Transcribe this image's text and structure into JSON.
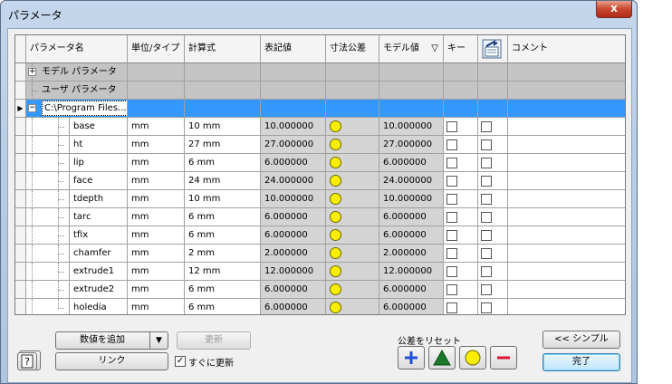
{
  "window": {
    "title": "パラメータ",
    "close": "x"
  },
  "columns": [
    "パラメータ名",
    "単位/タイプ",
    "計算式",
    "表記値",
    "寸法公差",
    "モデル値",
    "キー",
    "",
    "コメント"
  ],
  "sort_arrow": "▽",
  "groups": [
    {
      "name": "モデル パラメータ",
      "expander": "+"
    },
    {
      "name": "ユーザ パラメータ",
      "expander": ""
    },
    {
      "name": "C:\\Program Files...",
      "expander": "−"
    }
  ],
  "rows": [
    {
      "name": "base",
      "unit": "mm",
      "expr": "10 mm",
      "nominal": "10.000000",
      "model": "10.000000"
    },
    {
      "name": "ht",
      "unit": "mm",
      "expr": "27 mm",
      "nominal": "27.000000",
      "model": "27.000000"
    },
    {
      "name": "lip",
      "unit": "mm",
      "expr": "6 mm",
      "nominal": "6.000000",
      "model": "6.000000"
    },
    {
      "name": "face",
      "unit": "mm",
      "expr": "24 mm",
      "nominal": "24.000000",
      "model": "24.000000"
    },
    {
      "name": "tdepth",
      "unit": "mm",
      "expr": "10 mm",
      "nominal": "10.000000",
      "model": "10.000000"
    },
    {
      "name": "tarc",
      "unit": "mm",
      "expr": "6 mm",
      "nominal": "6.000000",
      "model": "6.000000"
    },
    {
      "name": "tfix",
      "unit": "mm",
      "expr": "6 mm",
      "nominal": "6.000000",
      "model": "6.000000"
    },
    {
      "name": "chamfer",
      "unit": "mm",
      "expr": "2 mm",
      "nominal": "2.000000",
      "model": "2.000000"
    },
    {
      "name": "extrude1",
      "unit": "mm",
      "expr": "12 mm",
      "nominal": "12.000000",
      "model": "12.000000"
    },
    {
      "name": "extrude2",
      "unit": "mm",
      "expr": "6 mm",
      "nominal": "6.000000",
      "model": "6.000000"
    },
    {
      "name": "holedia",
      "unit": "mm",
      "expr": "6 mm",
      "nominal": "6.000000",
      "model": "6.000000"
    }
  ],
  "footer": {
    "add_numeric": "数値を追加",
    "update": "更新",
    "link": "リンク",
    "immediate_update": "すぐに更新",
    "reset_tolerance": "公差をリセット",
    "simple": "<< シンプル",
    "done": "完了",
    "filter_icon": "filter-icon",
    "help_icon": "help-icon"
  },
  "colors": {
    "selection": "#3399ff",
    "group": "#c4c4c4",
    "tolerance": "#ffee00",
    "plus": "#1f4fd8",
    "triangle": "#1a7a2a",
    "minus": "#dd1133"
  }
}
